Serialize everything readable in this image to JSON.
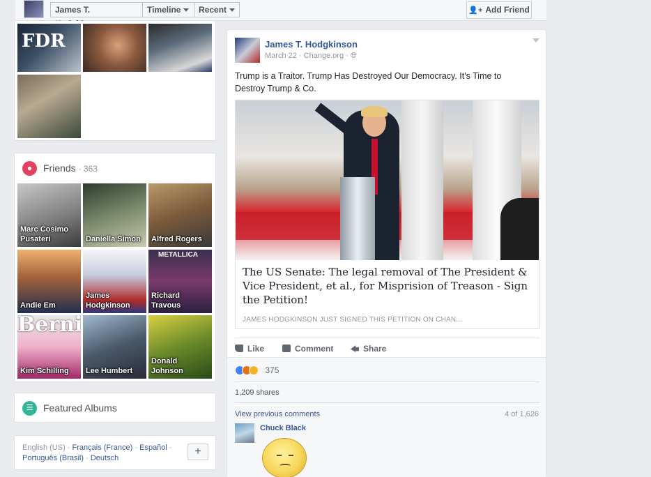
{
  "topbar": {
    "profile_name": "James T. Hodgkinson",
    "timeline_label": "Timeline",
    "recent_label": "Recent",
    "add_friend_label": "Add Friend"
  },
  "photos": {
    "fdr_label": "FDR"
  },
  "friends": {
    "title": "Friends",
    "count": "· 363",
    "items": [
      {
        "name": "Marc Cosimo Pusateri"
      },
      {
        "name": "Daniella Simon"
      },
      {
        "name": "Alfred Rogers"
      },
      {
        "name": "Andie Em"
      },
      {
        "name": "James Hodgkinson"
      },
      {
        "name": "Richard Travous"
      },
      {
        "name": "Kim Schilling"
      },
      {
        "name": "Lee Humbert"
      },
      {
        "name": "Donald Johnson"
      }
    ],
    "bernie_text": "Bernie",
    "metallica_text": "METALLICA"
  },
  "albums": {
    "title": "Featured Albums"
  },
  "languages": {
    "current": "English (US)",
    "links": [
      "Français (France)",
      "Español",
      "Português (Brasil)",
      "Deutsch"
    ],
    "plus_label": "+"
  },
  "post": {
    "author": "James T. Hodgkinson",
    "date": "March 22",
    "source": "Change.org",
    "text": "Trump is a Traitor. Trump Has Destroyed Our Democracy. It's Time to Destroy Trump & Co.",
    "link_title": "The US Senate: The legal removal of The President & Vice President, et al., for Misprision of Treason - Sign the Petition!",
    "link_caption": "JAMES HODGKINSON JUST SIGNED THIS PETITION ON CHAN...",
    "actions": {
      "like": "Like",
      "comment": "Comment",
      "share": "Share"
    },
    "reaction_count": "375",
    "shares": "1,209 shares",
    "view_previous": "View previous comments",
    "comment_count": "4 of 1,626",
    "commenter": "Chuck Black"
  },
  "icons": {
    "friends": "friends-icon",
    "albums": "albums-icon",
    "like": "like-icon",
    "comment": "comment-icon",
    "share": "share-icon",
    "globe": "globe-icon"
  },
  "colors": {
    "link_blue": "#365899",
    "friends_pink": "#e4405f",
    "albums_teal": "#35b597",
    "reaction_like": "#4080ff"
  }
}
